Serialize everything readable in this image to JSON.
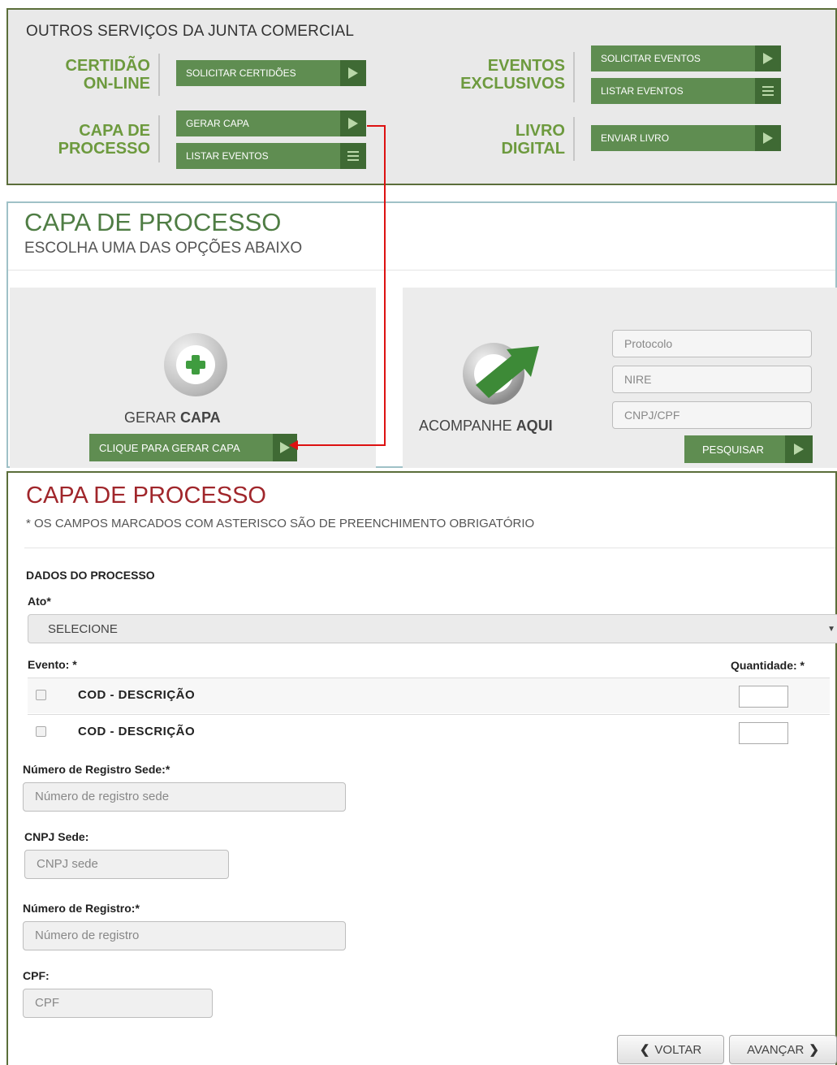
{
  "services": {
    "header": "OUTROS SERVIÇOS DA JUNTA COMERCIAL",
    "certidao": {
      "label_1": "CERTIDÃO",
      "label_2": "ON-LINE",
      "btn_solicitar": "SOLICITAR CERTIDÕES"
    },
    "capa": {
      "label_1": "CAPA DE",
      "label_2": "PROCESSO",
      "btn_gerar": "GERAR CAPA",
      "btn_listar": "LISTAR EVENTOS"
    },
    "eventos": {
      "label_1": "EVENTOS",
      "label_2": "EXCLUSIVOS",
      "btn_solicitar": "SOLICITAR EVENTOS",
      "btn_listar": "LISTAR EVENTOS"
    },
    "livro": {
      "label_1": "LIVRO",
      "label_2": "DIGITAL",
      "btn_enviar": "ENVIAR LIVRO"
    }
  },
  "escolha": {
    "title": "CAPA DE PROCESSO",
    "subtitle": "ESCOLHA UMA DAS OPÇÕES ABAIXO",
    "gerar_label_a": "GERAR ",
    "gerar_label_b": "CAPA",
    "gerar_button": "CLIQUE PARA GERAR CAPA",
    "acompanhe_label_a": "ACOMPANHE ",
    "acompanhe_label_b": "AQUI",
    "protocolo_placeholder": "Protocolo",
    "nire_placeholder": "NIRE",
    "cnpj_cpf_placeholder": "CNPJ/CPF",
    "pesquisar_button": "PESQUISAR"
  },
  "form": {
    "title": "CAPA DE PROCESSO",
    "note": "* OS CAMPOS MARCADOS COM ASTERISCO SÃO DE PREENCHIMENTO OBRIGATÓRIO",
    "section": "DADOS DO PROCESSO",
    "ato_label": "Ato*",
    "ato_value": "SELECIONE",
    "evento_label": "Evento: *",
    "quantidade_label": "Quantidade: *",
    "events": [
      {
        "text": "COD - DESCRIÇÃO"
      },
      {
        "text": "COD - DESCRIÇÃO"
      }
    ],
    "registro_sede_label": "Número de Registro Sede:*",
    "registro_sede_placeholder": "Número de registro sede",
    "cnpj_sede_label": "CNPJ Sede:",
    "cnpj_sede_placeholder": "CNPJ sede",
    "registro_label": "Número de Registro:*",
    "registro_placeholder": "Número de registro",
    "cpf_label": "CPF:",
    "cpf_placeholder": "CPF",
    "voltar": "VOLTAR",
    "avancar": "AVANÇAR"
  },
  "colors": {
    "green": "#5f8d51",
    "dark_green": "#3f6a34",
    "title_red": "#a0262b",
    "connector": "#dd1111"
  }
}
